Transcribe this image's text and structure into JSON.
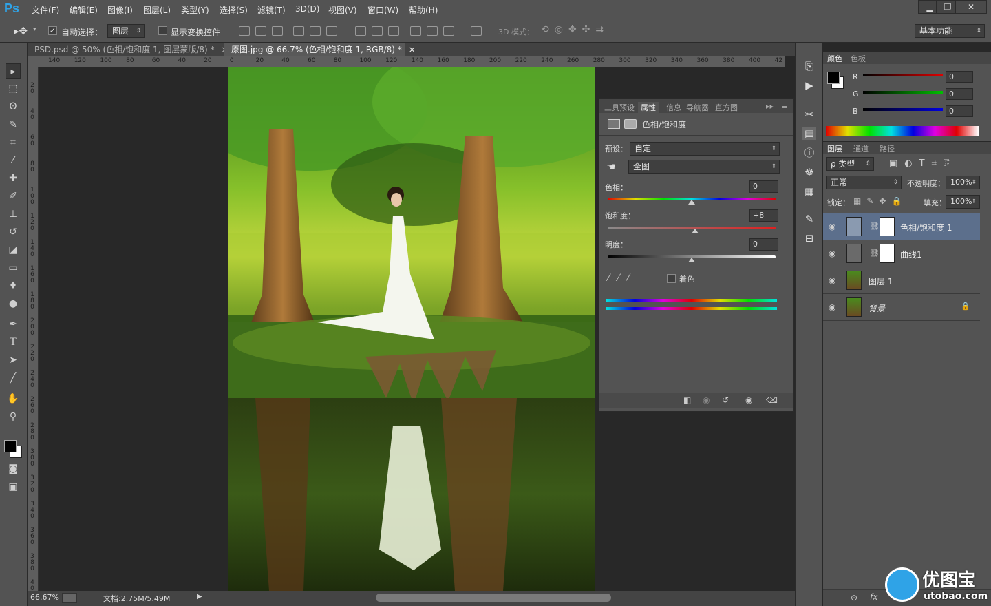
{
  "app": {
    "logo": "Ps"
  },
  "menu": [
    "文件(F)",
    "编辑(E)",
    "图像(I)",
    "图层(L)",
    "类型(Y)",
    "选择(S)",
    "滤镜(T)",
    "3D(D)",
    "视图(V)",
    "窗口(W)",
    "帮助(H)"
  ],
  "window_controls": {
    "minimize": "▁",
    "restore": "❐",
    "close": "✕"
  },
  "options_bar": {
    "auto_select_label": "自动选择：",
    "auto_select_checked": true,
    "auto_select_target": "图层",
    "show_transform_label": "显示变换控件",
    "mode_3d_label": "3D 模式：",
    "workspace": "基本功能"
  },
  "tabs": [
    {
      "label": "PSD.psd @ 50% (色相/饱和度 1, 图层蒙版/8) *",
      "active": false
    },
    {
      "label": "原图.jpg @ 66.7% (色相/饱和度 1, RGB/8) *",
      "active": true
    }
  ],
  "ruler": {
    "h_ticks": [
      "140",
      "120",
      "100",
      "80",
      "60",
      "40",
      "20",
      "0",
      "20",
      "40",
      "60",
      "80",
      "100",
      "120",
      "140",
      "160",
      "180",
      "200",
      "220",
      "240",
      "260",
      "280",
      "300",
      "320",
      "340",
      "360",
      "380",
      "400",
      "42"
    ],
    "v_ticks": [
      "20",
      "40",
      "60",
      "80",
      "100",
      "120",
      "140",
      "160",
      "180",
      "200",
      "220",
      "240",
      "260",
      "280",
      "300",
      "320",
      "340",
      "360",
      "380",
      "400"
    ]
  },
  "status": {
    "zoom": "66.67%",
    "doc": "文档:2.75M/5.49M"
  },
  "properties": {
    "tabs": [
      "工具预设",
      "属性",
      "信息",
      "导航器",
      "直方图"
    ],
    "active_tab": "属性",
    "title": "色相/饱和度",
    "preset_label": "预设：",
    "preset_value": "自定",
    "channel_value": "全图",
    "hue_label": "色相：",
    "hue_value": "0",
    "hue_pos": 0.5,
    "sat_label": "饱和度：",
    "sat_value": "+8",
    "sat_pos": 0.52,
    "light_label": "明度：",
    "light_value": "0",
    "light_pos": 0.5,
    "colorize_label": "着色",
    "colorize_checked": false
  },
  "color_panel": {
    "tabs": [
      "颜色",
      "色板"
    ],
    "channels": [
      {
        "label": "R",
        "value": "0"
      },
      {
        "label": "G",
        "value": "0"
      },
      {
        "label": "B",
        "value": "0"
      }
    ]
  },
  "layers_panel": {
    "tabs": [
      "图层",
      "通道",
      "路径"
    ],
    "filter_label": "ρ 类型",
    "blend_mode": "正常",
    "opacity_label": "不透明度：",
    "opacity_value": "100%",
    "lock_label": "锁定：",
    "fill_label": "填充：",
    "fill_value": "100%",
    "layers": [
      {
        "name": "色相/饱和度 1",
        "type": "adjustment-hue",
        "selected": true
      },
      {
        "name": "曲线1",
        "type": "adjustment-curves",
        "selected": false
      },
      {
        "name": "图层 1",
        "type": "pixel",
        "selected": false
      },
      {
        "name": "背景",
        "type": "background",
        "selected": false,
        "locked": true
      }
    ],
    "footer_icons": [
      "link-icon",
      "fx-icon"
    ]
  },
  "watermark": {
    "text": "优图宝",
    "url": "utobao.com"
  },
  "colors": {
    "accent": "#2fa3e7",
    "panel": "#535353",
    "dark": "#282828",
    "selected_layer": "#5c6f8c"
  }
}
